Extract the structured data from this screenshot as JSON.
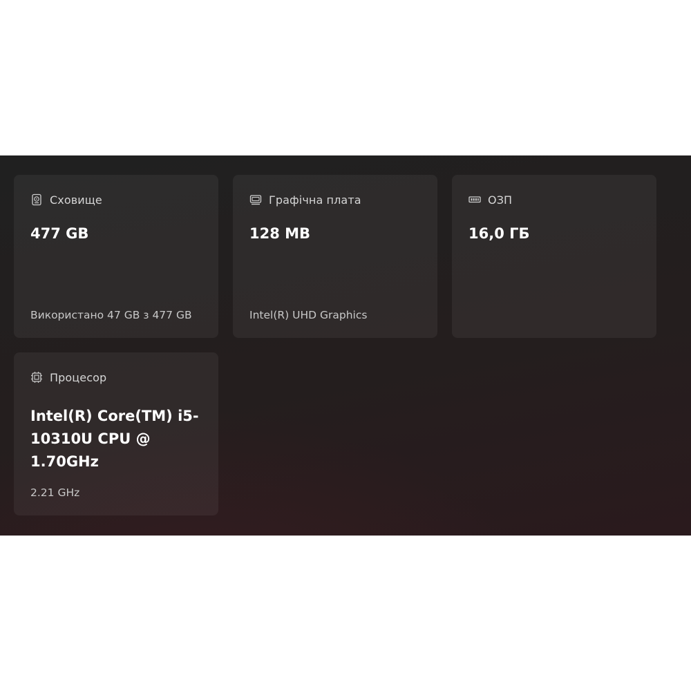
{
  "cards": [
    {
      "icon": "hard-drive-icon",
      "label": "Сховище",
      "value": "477 GB",
      "detail": "Використано 47 GB з 477 GB"
    },
    {
      "icon": "display-adapter-icon",
      "label": "Графічна плата",
      "value": "128 MB",
      "detail": "Intel(R) UHD Graphics"
    },
    {
      "icon": "memory-icon",
      "label": "ОЗП",
      "value": "16,0 ГБ",
      "detail": ""
    },
    {
      "icon": "processor-icon",
      "label": "Процесор",
      "value": "Intel(R) Core(TM) i5-10310U CPU @ 1.70GHz",
      "detail": "2.21 GHz"
    }
  ]
}
